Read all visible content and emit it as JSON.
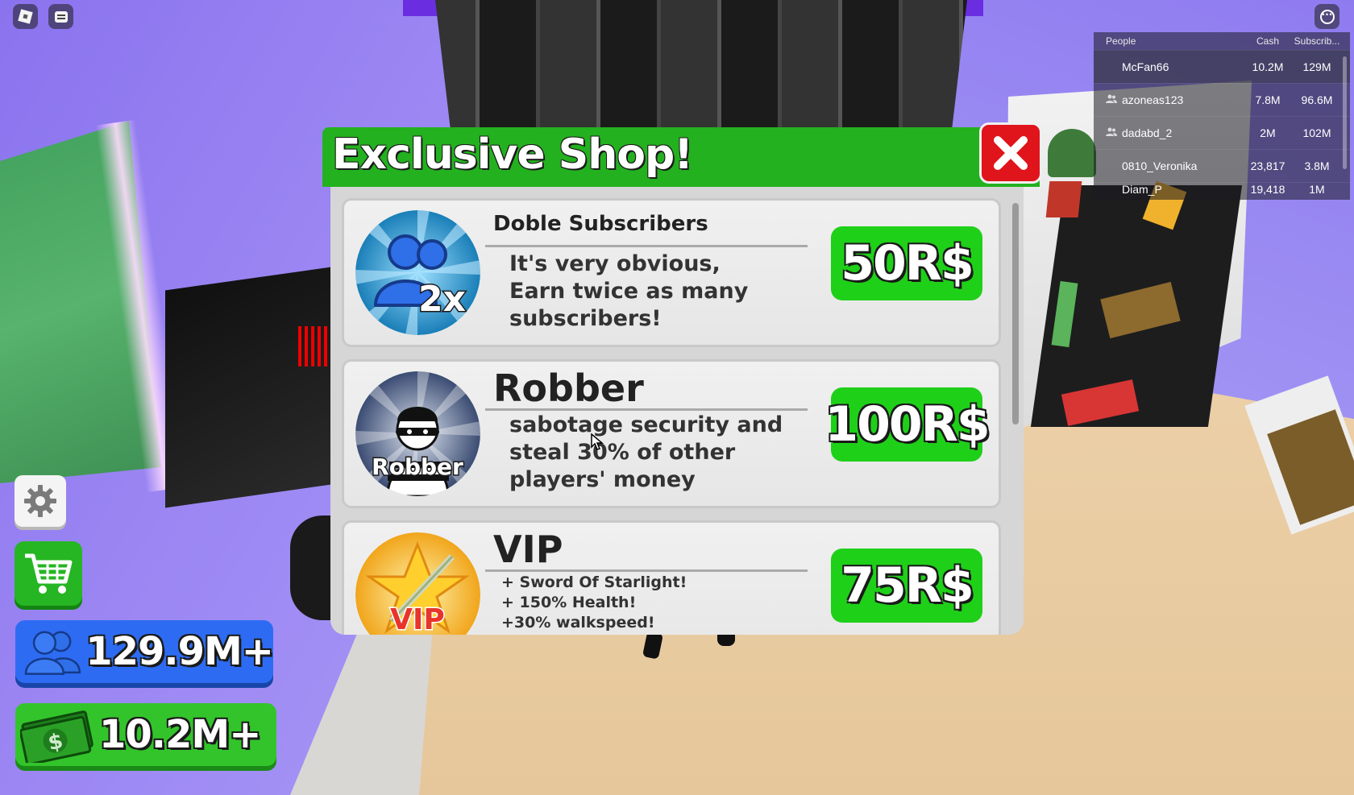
{
  "topbar": {
    "roblox_menu_icon": "roblox-logo-icon",
    "chat_icon": "chat-icon",
    "more_icon": "more-options-icon"
  },
  "leaderboard": {
    "headers": {
      "people": "People",
      "cash": "Cash",
      "subscribers": "Subscrib..."
    },
    "rows": [
      {
        "name": "McFan66",
        "cash": "10.2M",
        "subs": "129M",
        "friend": false
      },
      {
        "name": "azoneas123",
        "cash": "7.8M",
        "subs": "96.6M",
        "friend": true
      },
      {
        "name": "dadabd_2",
        "cash": "2M",
        "subs": "102M",
        "friend": true
      },
      {
        "name": "0810_Veronika",
        "cash": "23,817",
        "subs": "3.8M",
        "friend": false
      },
      {
        "name": "Diam_P",
        "cash": "19,418",
        "subs": "1M",
        "friend": false
      }
    ]
  },
  "shop": {
    "title": "Exclusive Shop!",
    "close_icon": "close-x-icon",
    "items": [
      {
        "name": "Doble Subscribers",
        "description": "It's very obvious, Earn twice as many subscribers!",
        "badge_text": "2x",
        "price": "50R$",
        "icon": "double-subscribers-icon"
      },
      {
        "name": "Robber",
        "description": "sabotage security and steal 30% of other players' money",
        "badge_text": "Robber",
        "price": "100R$",
        "icon": "robber-icon"
      },
      {
        "name": "VIP",
        "perks": [
          "+ Sword Of Starlight!",
          "+ 150% Health!",
          "+30% walkspeed!"
        ],
        "badge_text": "VIP",
        "price": "75R$",
        "icon": "vip-star-icon"
      }
    ]
  },
  "hud": {
    "settings_icon": "gear-icon",
    "shop_icon": "shopping-cart-icon",
    "subscribers_value": "129.9M+",
    "cash_value": "10.2M+",
    "subscribers_icon": "people-icon",
    "cash_icon": "cash-icon"
  },
  "colors": {
    "shop_green": "#23b11f",
    "price_green": "#1fd019",
    "close_red": "#e0141b",
    "subs_blue": "#2d6cf2",
    "cash_green": "#33c42b"
  }
}
